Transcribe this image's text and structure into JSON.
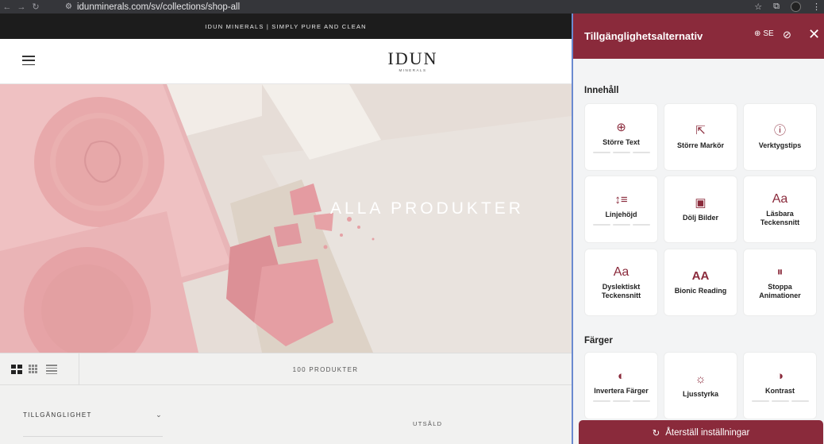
{
  "browser": {
    "url": "idunminerals.com/sv/collections/shop-all"
  },
  "page": {
    "announcement": "IDUN MINERALS | SIMPLY PURE AND CLEAN",
    "logo": {
      "brand": "IDUN",
      "sub": "MINERALS"
    },
    "hero": {
      "title": "ALLA PRODUKTER",
      "compact_text_1": "SIMPLY PURE AND CLEAN",
      "compact_text_2": "SIMPLY PURE AND CLEAN"
    },
    "product_count": "100 PRODUKTER",
    "filters": [
      {
        "label": "TILLGÄNGLIGHET"
      }
    ],
    "sold_out_label": "UTSÅLD"
  },
  "accessibility_panel": {
    "title": "Tillgänglighetsalternativ",
    "language": "SE",
    "sections": [
      {
        "label": "Innehåll",
        "cards": [
          {
            "label": "Större Text",
            "icon": "zoom-in-icon",
            "steps": true
          },
          {
            "label": "Större Markör",
            "icon": "cursor-icon",
            "steps": false
          },
          {
            "label": "Verktygstips",
            "icon": "tooltip-icon",
            "steps": false
          },
          {
            "label": "Linjehöjd",
            "icon": "line-height-icon",
            "steps": true
          },
          {
            "label": "Dölj Bilder",
            "icon": "image-icon",
            "steps": false
          },
          {
            "label": "Läsbara Teckensnitt",
            "icon": "readable-font-icon",
            "steps": false
          },
          {
            "label": "Dyslektiskt Teckensnitt",
            "icon": "dyslexic-font-icon",
            "steps": false
          },
          {
            "label": "Bionic Reading",
            "icon": "bionic-reading-icon",
            "steps": false
          },
          {
            "label": "Stoppa Animationer",
            "icon": "pause-icon",
            "steps": false
          }
        ]
      },
      {
        "label": "Färger",
        "cards": [
          {
            "label": "Invertera Färger",
            "icon": "invert-icon",
            "steps": true
          },
          {
            "label": "Ljusstyrka",
            "icon": "brightness-icon",
            "steps": false
          },
          {
            "label": "Kontrast",
            "icon": "contrast-icon",
            "steps": true
          }
        ]
      }
    ],
    "reset_label": "Återställ inställningar"
  },
  "colors": {
    "accent": "#8a2a3b",
    "panel_bg": "#f3f4f5"
  }
}
